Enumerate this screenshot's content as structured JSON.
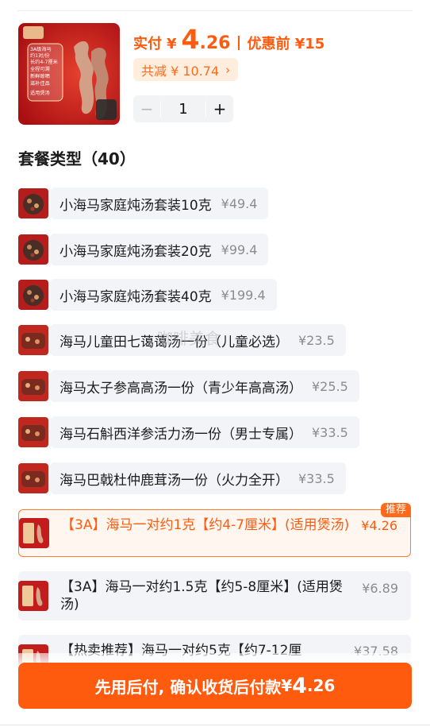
{
  "header": {
    "image_text": [
      "3A级海马",
      "约1对/份",
      "长约4-7厘米",
      "全程可溯",
      "新鲜晾晒",
      "滋补佳品",
      "适用煲汤"
    ],
    "price_label": "实付",
    "price_currency": "¥",
    "price_integer": "4",
    "price_decimal": ".26",
    "price_before": "优惠前 ¥15",
    "discount_text": "共减 ¥ 10.74",
    "discount_chevron_icon": "chevron-right-icon",
    "quantity": "1",
    "minus_icon": "minus-icon",
    "plus_icon": "plus-icon"
  },
  "section": {
    "title": "套餐类型（40）"
  },
  "variants": [
    {
      "name": "小海马家庭炖汤套装10克",
      "price": "¥49.4"
    },
    {
      "name": "小海马家庭炖汤套装20克",
      "price": "¥99.4"
    },
    {
      "name": "小海马家庭炖汤套装40克",
      "price": "¥199.4"
    },
    {
      "name": "海马儿童田七蔼蔼汤一份（儿童必选）",
      "price": "¥23.5"
    },
    {
      "name": "海马太子参高高汤一份（青少年高高汤）",
      "price": "¥25.5"
    },
    {
      "name": "海马石斛西洋参活力汤一份（男士专属）",
      "price": "¥33.5"
    },
    {
      "name": "海马巴戟杜仲鹿茸汤一份（火力全开）",
      "price": "¥33.5"
    },
    {
      "name": "【3A】海马一对约1克【约4-7厘米】(适用煲汤)",
      "price": "¥4.26",
      "badge": "推荐"
    },
    {
      "name": "【3A】海马一对约1.5克【约5-8厘米】(适用煲汤)",
      "price": "¥6.89"
    },
    {
      "name": "【热卖推荐】海马一对约5克【约7-12厘",
      "price": "¥37.58"
    }
  ],
  "watermark": "咖啡美食",
  "cta": {
    "text": "先用后付, 确认收货后付款",
    "currency": "¥",
    "price_integer": "4",
    "price_decimal": ".26"
  },
  "colors": {
    "accent": "#ff5b0f",
    "pill_bg": "#ffeedd",
    "row_bg": "#f3f4f7",
    "selected_bg": "#fff6ef",
    "muted_price": "#8c8c8c"
  }
}
